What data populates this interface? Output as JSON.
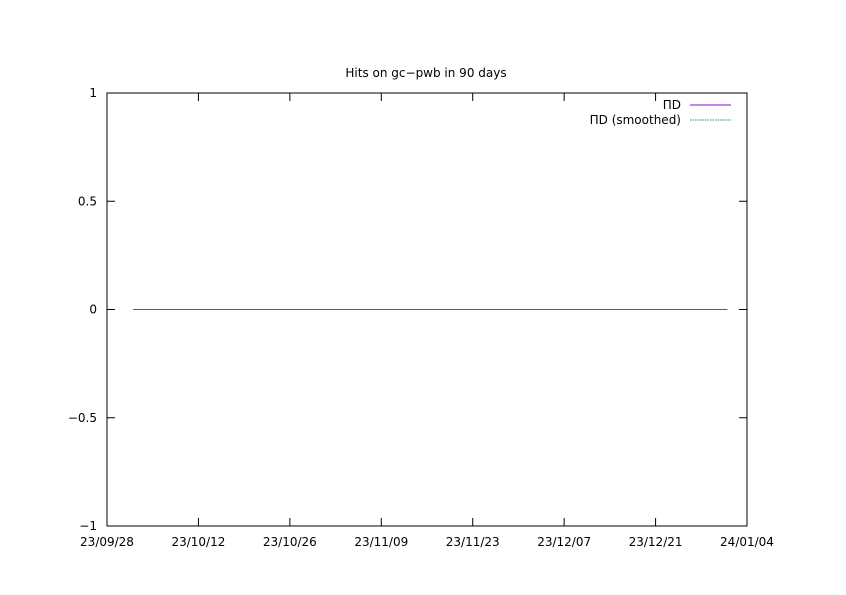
{
  "chart_data": {
    "type": "line",
    "title": "Hits on gc−pwb in 90 days",
    "xlabel": "",
    "ylabel": "",
    "x_ticks": [
      "23/09/28",
      "23/10/12",
      "23/10/26",
      "23/11/09",
      "23/11/23",
      "23/12/07",
      "23/12/21",
      "24/01/04"
    ],
    "y_ticks": [
      "1",
      "0.5",
      "0",
      "−0.5",
      "−1"
    ],
    "xlim": [
      "2023-09-28",
      "2024-01-04"
    ],
    "ylim": [
      -1,
      1
    ],
    "grid": false,
    "legend_position": "top-right",
    "series": [
      {
        "name": "ΠD",
        "color": "#9400d3",
        "x": [
          "2023-10-02",
          "2024-01-01"
        ],
        "y": [
          0,
          0
        ]
      },
      {
        "name": "ΠD (smoothed)",
        "color": "#009e73",
        "x": [
          "2023-10-02",
          "2024-01-01"
        ],
        "y": [
          0,
          0
        ]
      }
    ]
  }
}
